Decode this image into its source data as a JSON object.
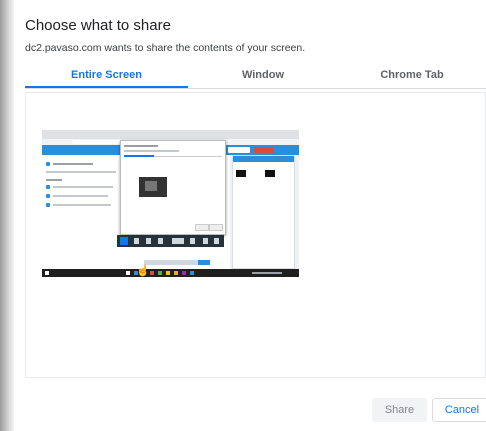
{
  "dialog": {
    "title": "Choose what to share",
    "subtitle": "dc2.pavaso.com wants to share the contents of your screen.",
    "tabs": [
      {
        "label": "Entire Screen",
        "active": true
      },
      {
        "label": "Window",
        "active": false
      },
      {
        "label": "Chrome Tab",
        "active": false
      }
    ]
  },
  "buttons": {
    "share_label": "Share",
    "share_enabled": false,
    "cancel_label": "Cancel"
  },
  "colors": {
    "accent": "#1a73e8",
    "app_bar": "#2b8ed8",
    "thumb_button_red": "#d94c3d",
    "taskbar": "#1f1f1f"
  }
}
